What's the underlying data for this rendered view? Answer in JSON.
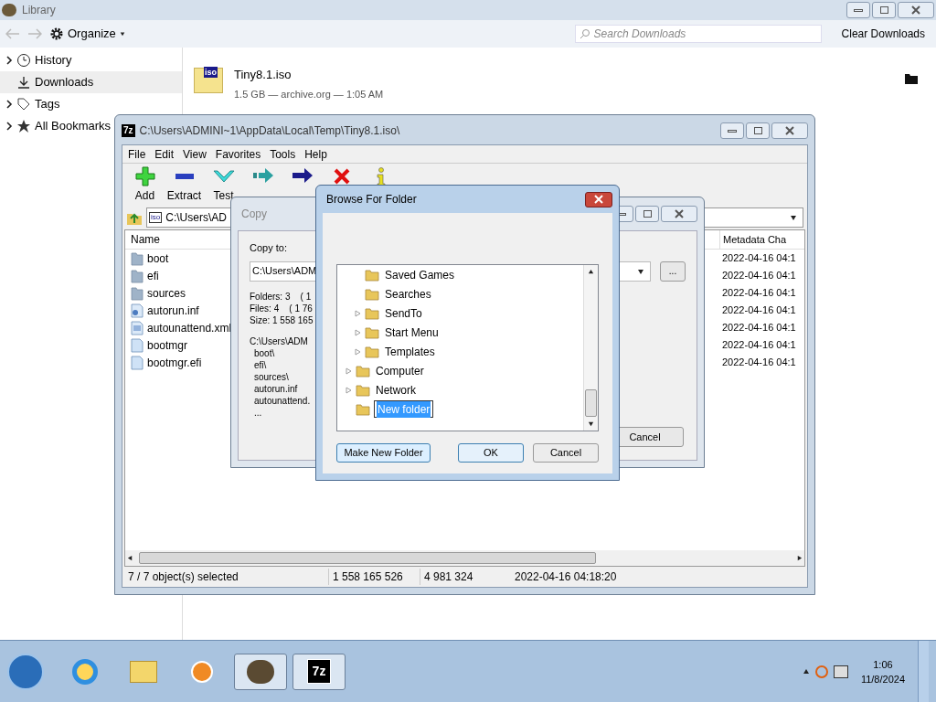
{
  "library": {
    "title": "Library",
    "organize": "Organize",
    "search": {
      "placeholder": "Search Downloads"
    },
    "clear_button": "Clear Downloads",
    "sidebar": [
      {
        "label": "History",
        "expandable": true,
        "selected": false
      },
      {
        "label": "Downloads",
        "expandable": false,
        "selected": true
      },
      {
        "label": "Tags",
        "expandable": true,
        "selected": false
      },
      {
        "label": "All Bookmarks",
        "expandable": true,
        "selected": false
      }
    ],
    "downloads": [
      {
        "name": "Tiny8.1.iso",
        "icon_text": "iso",
        "details": "1.5 GB — archive.org — 1:05 AM"
      }
    ]
  },
  "archive_window": {
    "icon_text": "7z",
    "title": "C:\\Users\\ADMINI~1\\AppData\\Local\\Temp\\Tiny8.1.iso\\",
    "menu": [
      "File",
      "Edit",
      "View",
      "Favorites",
      "Tools",
      "Help"
    ],
    "toolbar": [
      "Add",
      "Extract",
      "Test"
    ],
    "path": {
      "icon_text": "iso",
      "value": "C:\\Users\\AD"
    },
    "columns": [
      "Name",
      "Metadata Cha"
    ],
    "rows": [
      {
        "name": "boot",
        "kind": "folder",
        "column_2": "2022-04-16 04:1"
      },
      {
        "name": "efi",
        "kind": "folder",
        "column_2": "2022-04-16 04:1"
      },
      {
        "name": "sources",
        "kind": "folder",
        "column_2": "2022-04-16 04:1"
      },
      {
        "name": "autorun.inf",
        "kind": "settings",
        "column_2": "2022-04-16 04:1"
      },
      {
        "name": "autounattend.xml",
        "kind": "document",
        "column_2": "2022-04-16 04:1"
      },
      {
        "name": "bootmgr",
        "kind": "file",
        "column_2": "2022-04-16 04:1"
      },
      {
        "name": "bootmgr.efi",
        "kind": "file",
        "column_2": "2022-04-16 04:1"
      }
    ],
    "status_bar": [
      "7 / 7 object(s) selected",
      "1 558 165 526",
      "4 981 324",
      "2022-04-16 04:18:20"
    ]
  },
  "copy_dialog": {
    "title": "Copy",
    "label": "Copy to:",
    "destination": "C:\\Users\\ADM",
    "browse_button": "...",
    "stats": [
      "Folders: 3    ( 1",
      "Files: 4    ( 1 76",
      "Size: 1 558 165"
    ],
    "listing": [
      "C:\\Users\\ADM",
      "boot\\",
      "efi\\",
      "sources\\",
      "autorun.inf",
      "autounattend.",
      "..."
    ],
    "cancel_button": "Cancel"
  },
  "browse_dialog": {
    "title": "Browse For Folder",
    "tree": [
      {
        "children": [
          {
            "label": "Saved Games",
            "expandable": false,
            "selected": false
          },
          {
            "label": "Searches",
            "expandable": false,
            "selected": false
          },
          {
            "label": "SendTo",
            "expandable": true,
            "selected": false
          },
          {
            "label": "Start Menu",
            "expandable": true,
            "selected": false
          },
          {
            "label": "Templates",
            "expandable": true,
            "selected": false
          }
        ]
      },
      {
        "label": "Computer",
        "expandable": true,
        "selected": false
      },
      {
        "label": "Network",
        "expandable": true,
        "selected": false
      },
      {
        "label": "New folder",
        "expandable": false,
        "selected": true
      }
    ],
    "buttons": [
      "Make New Folder",
      "OK",
      "Cancel"
    ]
  },
  "taskbar": {
    "items": [
      {
        "selected": false
      },
      {
        "selected": false
      },
      {
        "selected": false
      },
      {
        "selected": true
      },
      {
        "selected": true,
        "icon_text": "7z"
      }
    ],
    "time": "1:06",
    "date": "11/8/2024"
  }
}
